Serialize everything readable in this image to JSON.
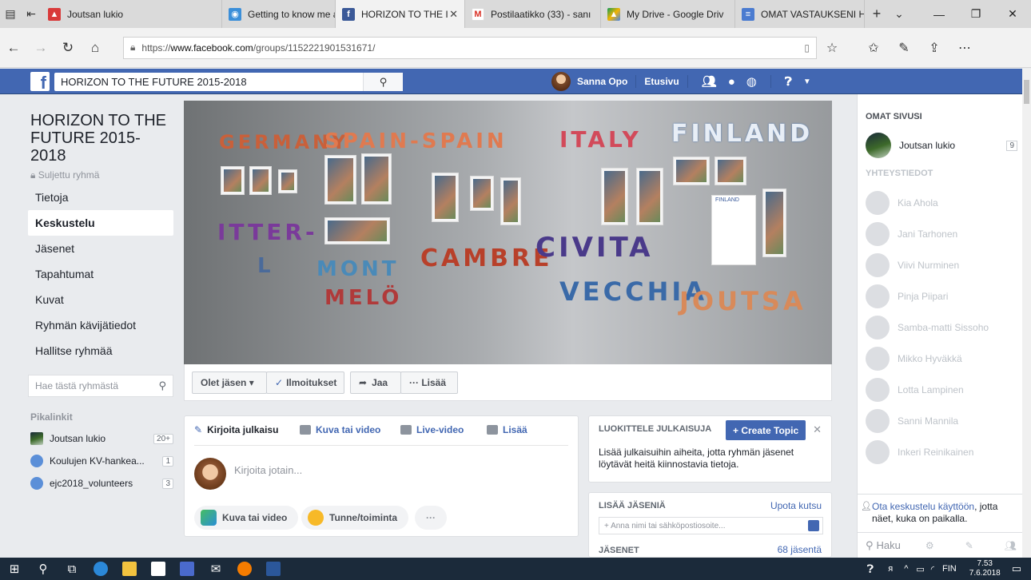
{
  "tabs": [
    {
      "label": "Joutsan lukio",
      "favicon": "#d93a3a",
      "active": false
    },
    {
      "label": "Getting to know me an",
      "favicon": "#3b8fd9",
      "active": false
    },
    {
      "label": "HORIZON TO THE I",
      "favicon": "#3b5998",
      "active": true
    },
    {
      "label": "Postilaatikko (33) - sanı",
      "favicon": "#d93025",
      "active": false
    },
    {
      "label": "My Drive - Google Driv",
      "favicon": "#f4b400",
      "active": false
    },
    {
      "label": "OMAT VASTAUKSENI H",
      "favicon": "#4a7bd0",
      "active": false
    }
  ],
  "address": {
    "prefix": "https://",
    "host": "www.facebook.com",
    "path": "/groups/1152221901531671/"
  },
  "fb": {
    "search_value": "HORIZON TO THE FUTURE 2015-2018",
    "user_name": "Sanna Opo",
    "home_label": "Etusivu"
  },
  "group": {
    "title": "HORIZON TO THE FUTURE 2015-2018",
    "type": "Suljettu ryhmä",
    "nav": [
      "Tietoja",
      "Keskustelu",
      "Jäsenet",
      "Tapahtumat",
      "Kuvat",
      "Ryhmän kävijätiedot",
      "Hallitse ryhmää"
    ],
    "active_nav": "Keskustelu",
    "search_placeholder": "Hae tästä ryhmästä"
  },
  "quicklinks": {
    "heading": "Pikalinkit",
    "items": [
      {
        "label": "Joutsan lukio",
        "badge": "20+"
      },
      {
        "label": "Koulujen KV-hankea...",
        "badge": "1"
      },
      {
        "label": "ejc2018_volunteers",
        "badge": "3"
      }
    ]
  },
  "cover": {
    "words": [
      "GERMANY",
      "SPAIN-SPAIN",
      "ITALY",
      "FINLAND",
      "ITTER-",
      "L",
      "MONT",
      "MELÖ",
      "CAMBRE",
      "CIVITA",
      "VECCHIA",
      "JOUTSA"
    ],
    "photo_label": "FINLAND"
  },
  "actions": {
    "member": "Olet jäsen ▾",
    "notifications": "Ilmoitukset",
    "share": "Jaa",
    "more": "··· Lisää"
  },
  "composer": {
    "tabs": [
      "Kirjoita julkaisu",
      "Kuva tai video",
      "Live-video",
      "Lisää"
    ],
    "placeholder": "Kirjoita jotain...",
    "pills": [
      "Kuva tai video",
      "Tunne/toiminta"
    ],
    "more": "···"
  },
  "topics": {
    "heading": "LUOKITTELE JULKAISUJA",
    "button": "+ Create Topic",
    "text": "Lisää julkaisuihin aiheita, jotta ryhmän jäsenet löytävät heitä kiinnostavia tietoja."
  },
  "members": {
    "heading": "LISÄÄ JÄSENIÄ",
    "invite": "Upota kutsu",
    "input_placeholder": "+ Anna nimi tai sähköpostiosoite...",
    "list_heading": "JÄSENET",
    "count": "68 jäsentä"
  },
  "right": {
    "heading": "OMAT SIVUSI",
    "page_name": "Joutsan lukio",
    "page_badge": "9",
    "contacts_heading": "YHTEYSTIEDOT",
    "contacts": [
      "Kia Ahola",
      "Jani Tarhonen",
      "Viivi Nurminen",
      "Pinja Piipari",
      "Samba-matti Sissoho",
      "Mikko Hyväkkä",
      "Lotta Lampinen",
      "Sanni Mannila",
      "Inkeri Reinikainen"
    ],
    "chat_link": "Ota keskustelu käyttöön",
    "chat_rest": ", jotta näet, kuka on paikalla.",
    "search_placeholder": "Haku"
  },
  "taskbar": {
    "lang": "FIN",
    "time": "7.53",
    "date": "7.6.2018"
  }
}
